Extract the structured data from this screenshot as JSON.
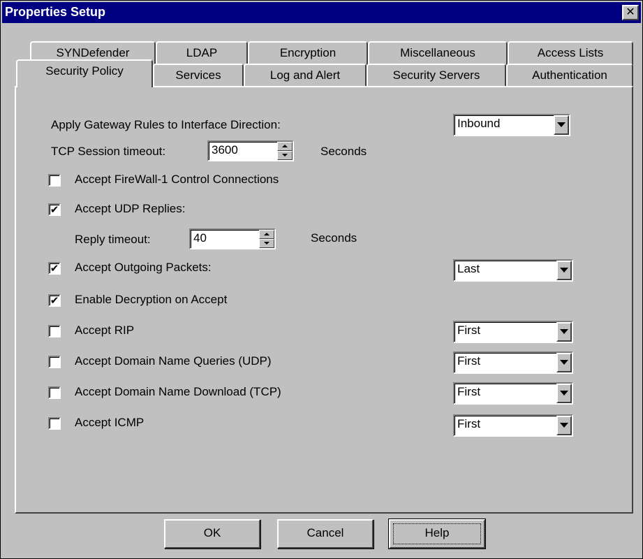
{
  "window": {
    "title": "Properties Setup"
  },
  "tabs_back": [
    "SYNDefender",
    "LDAP",
    "Encryption",
    "Miscellaneous",
    "Access Lists"
  ],
  "tabs_front": [
    "Security Policy",
    "Services",
    "Log and Alert",
    "Security Servers",
    "Authentication"
  ],
  "active_tab": "Security Policy",
  "settings": {
    "gateway_rules_label": "Apply Gateway Rules to Interface Direction:",
    "gateway_rules_value": "Inbound",
    "tcp_timeout_label": "TCP Session timeout:",
    "tcp_timeout_value": "3600",
    "tcp_timeout_unit": "Seconds",
    "control_conn": {
      "label": "Accept FireWall-1 Control Connections",
      "checked": false
    },
    "udp_replies": {
      "label": "Accept UDP Replies:",
      "checked": true
    },
    "reply_timeout_label": "Reply timeout:",
    "reply_timeout_value": "40",
    "reply_timeout_unit": "Seconds",
    "outgoing": {
      "label": "Accept Outgoing Packets:",
      "checked": true,
      "position": "Last"
    },
    "decryption": {
      "label": "Enable Decryption on Accept",
      "checked": true
    },
    "rip": {
      "label": "Accept RIP",
      "checked": false,
      "position": "First"
    },
    "dns_queries": {
      "label": "Accept Domain Name Queries (UDP)",
      "checked": false,
      "position": "First"
    },
    "dns_download": {
      "label": "Accept Domain Name Download (TCP)",
      "checked": false,
      "position": "First"
    },
    "icmp": {
      "label": "Accept ICMP",
      "checked": false,
      "position": "First"
    }
  },
  "buttons": {
    "ok": "OK",
    "cancel": "Cancel",
    "help": "Help"
  },
  "colors": {
    "titlebar": "#000080",
    "face": "#c0c0c0"
  }
}
